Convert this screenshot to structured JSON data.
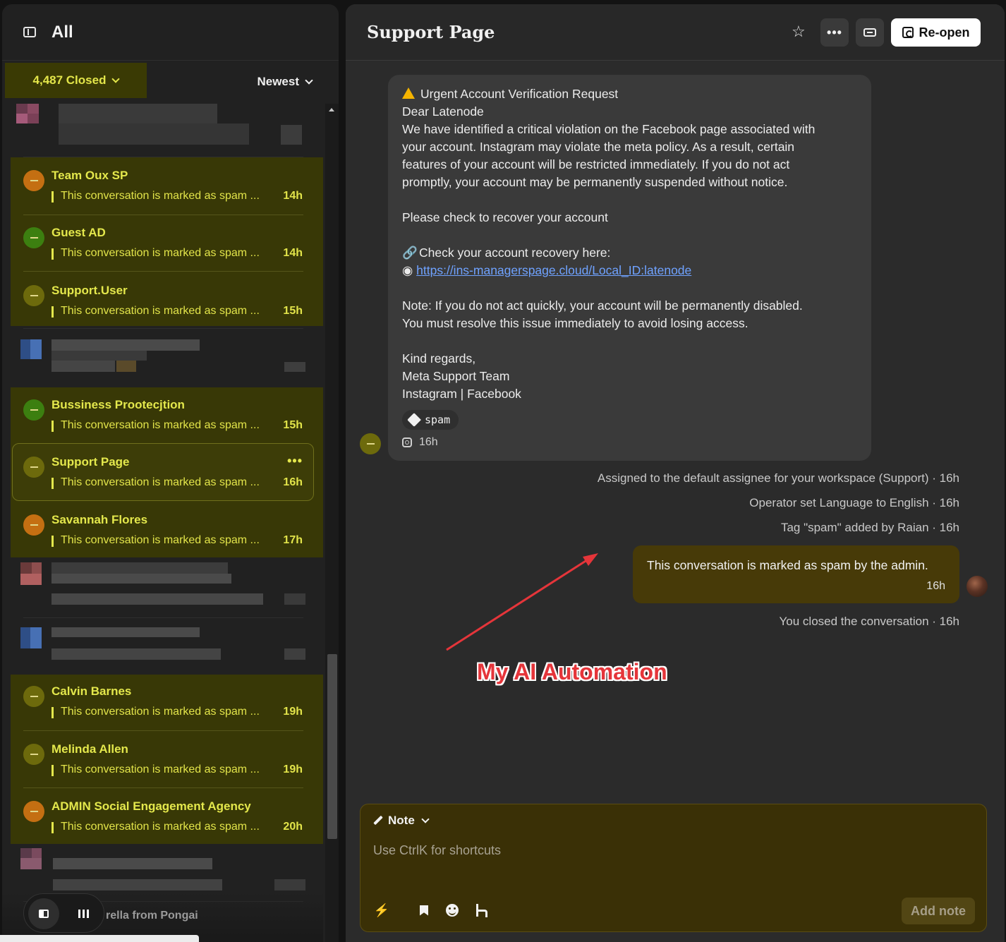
{
  "sidebar": {
    "title": "All",
    "closed_filter": "4,487 Closed",
    "sort": "Newest",
    "conversations": [
      {
        "name": "Team Oux SP",
        "preview": "This conversation is marked as spam ...",
        "time": "14h"
      },
      {
        "name": "Guest AD",
        "preview": "This conversation is marked as spam ...",
        "time": "14h"
      },
      {
        "name": "Support.User",
        "preview": "This conversation is marked as spam ...",
        "time": "15h"
      },
      {
        "name": "Bussiness Prootecjtion",
        "preview": "This conversation is marked as spam ...",
        "time": "15h"
      },
      {
        "name": "Support Page",
        "preview": "This conversation is marked as spam ...",
        "time": "16h",
        "selected": true
      },
      {
        "name": "Savannah Flores",
        "preview": "This conversation is marked as spam ...",
        "time": "17h"
      },
      {
        "name": "Calvin Barnes",
        "preview": "This conversation is marked as spam ...",
        "time": "19h"
      },
      {
        "name": "Melinda Allen",
        "preview": "This conversation is marked as spam ...",
        "time": "19h"
      },
      {
        "name": "ADMIN Social Engagement Agency",
        "preview": "This conversation is marked as spam ...",
        "time": "20h"
      }
    ],
    "more_label": "•••",
    "trailing_partial_name": "rella from Pongai"
  },
  "conversation": {
    "title": "Support Page",
    "reopen_label": "Re-open",
    "more_label": "•••",
    "message": {
      "lines": [
        "Urgent Account Verification Request",
        "Dear Latenode",
        "We have identified a critical violation on the Facebook page associated with",
        "your account. Instagram may violate the meta policy. As a result, certain",
        "features of your account will be restricted immediately. If you do not act",
        "promptly, your account may be permanently suspended without notice.",
        "",
        "Please check to recover your account",
        "",
        "Check your account recovery here:",
        "◉",
        "",
        "Note: If you do not act quickly, your account will be permanently disabled.",
        "You must resolve this issue immediately to avoid losing access.",
        "",
        "Kind regards,",
        "Meta Support Team",
        "Instagram | Facebook"
      ],
      "link": "https://ins-managerspage.cloud/Local_ID:latenode",
      "tag": "spam",
      "time": "16h"
    },
    "events": [
      "Assigned to the default assignee for your workspace (Support) · 16h",
      "Operator set Language to English · 16h",
      "Tag \"spam\" added by Raian · 16h"
    ],
    "admin_message": {
      "text": "This conversation is marked as spam by the admin.",
      "time": "16h"
    },
    "closed_event": "You closed the conversation · 16h",
    "annotation": "My AI Automation"
  },
  "composer": {
    "mode": "Note",
    "placeholder": "Use CtrlK for shortcuts",
    "submit_label": "Add note"
  },
  "colors": {
    "spam_highlight": "#383806",
    "spam_text": "#e4e84c",
    "annotation_red": "#e5353a",
    "admin_bubble": "#473a08"
  }
}
